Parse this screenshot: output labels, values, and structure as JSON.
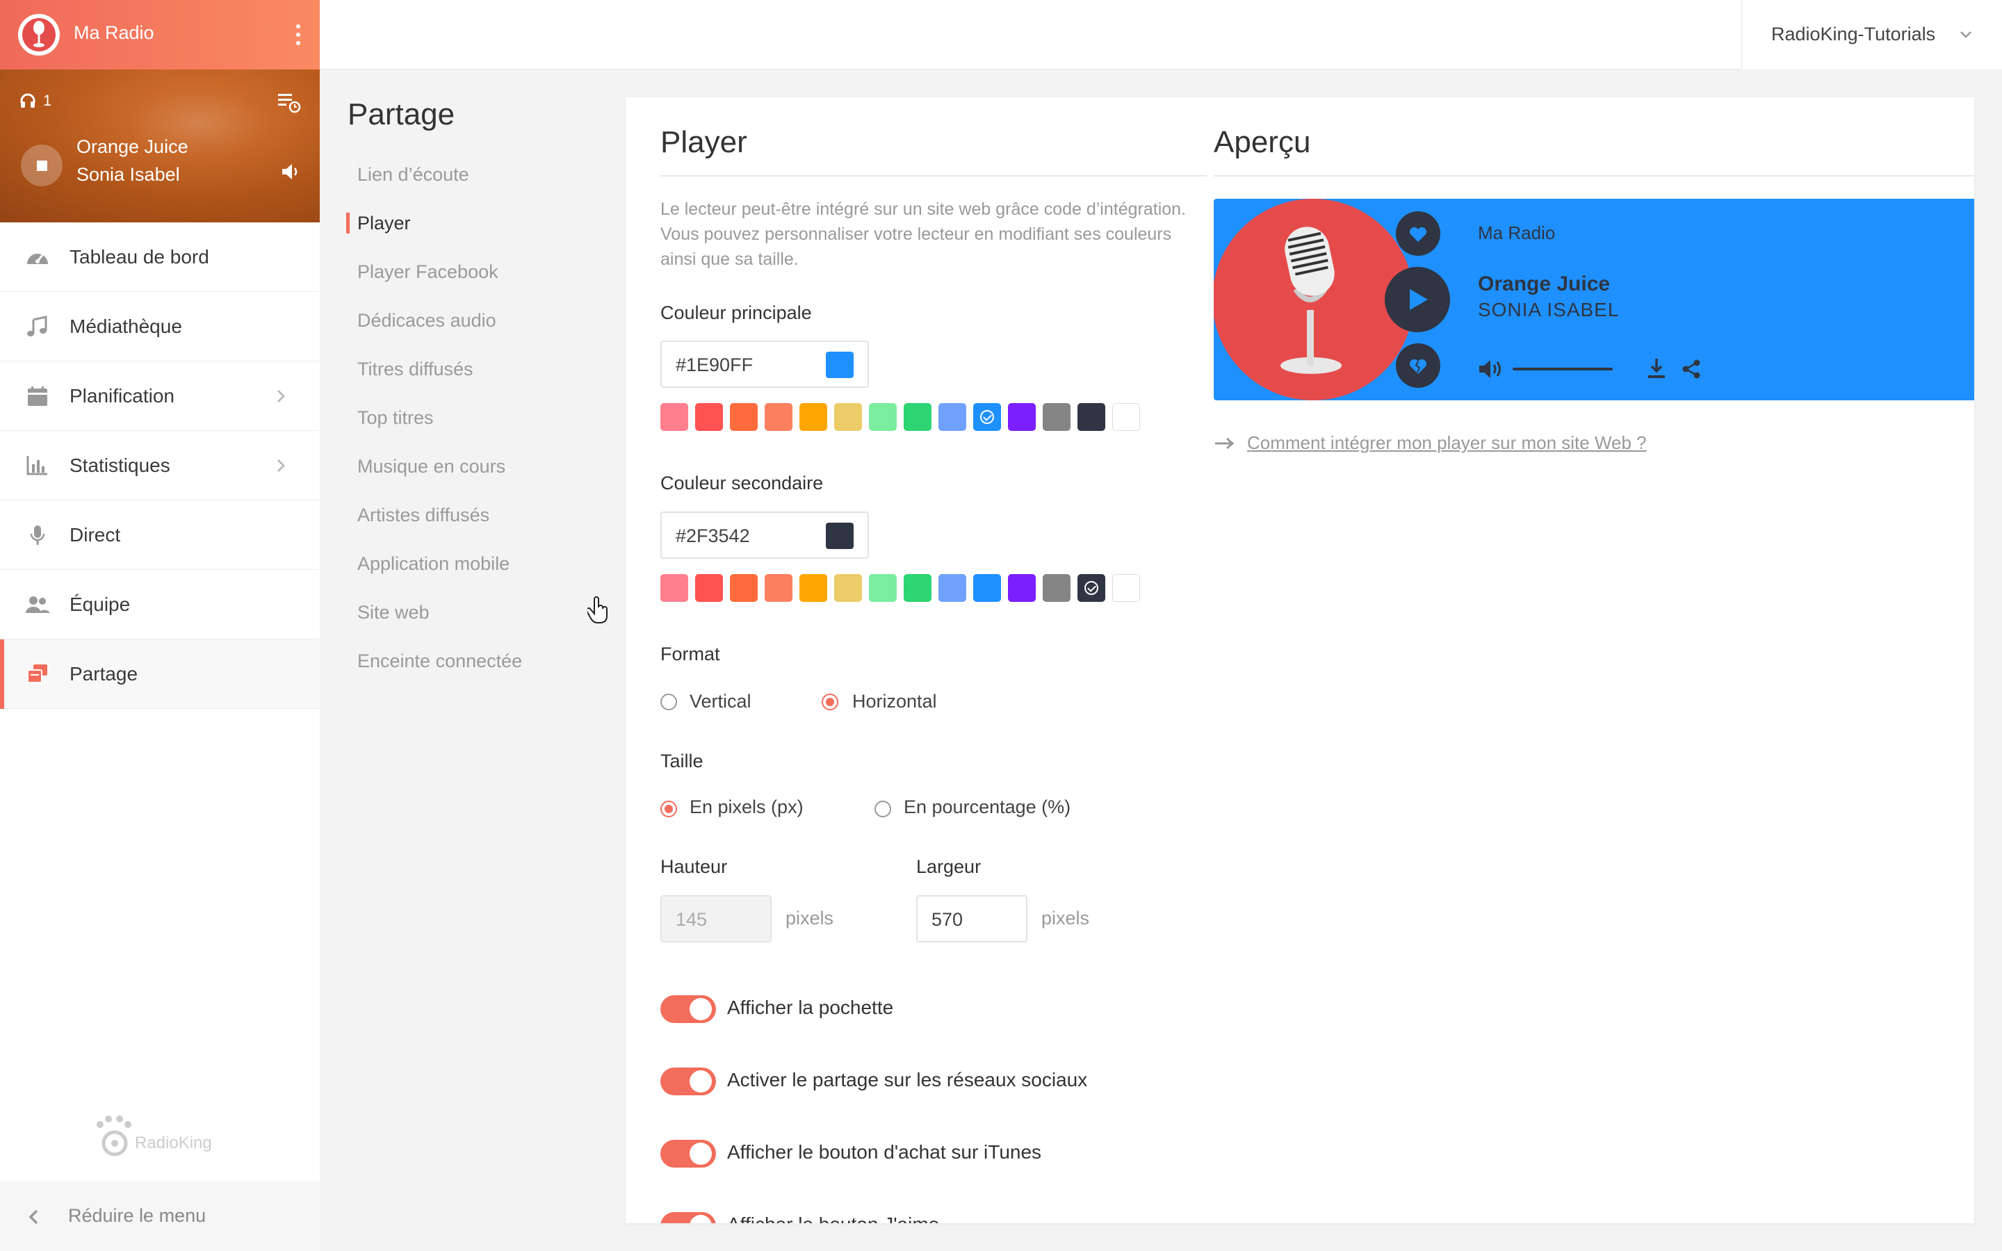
{
  "app": {
    "station_name": "Ma Radio",
    "account_name": "RadioKing-Tutorials",
    "brand_logo_text": "RadioKing"
  },
  "now_playing": {
    "listeners": "1",
    "title": "Orange Juice",
    "artist": "Sonia Isabel"
  },
  "sidebar": {
    "items": [
      {
        "label": "Tableau de bord",
        "icon": "dashboard-icon"
      },
      {
        "label": "Médiathèque",
        "icon": "music-note-icon"
      },
      {
        "label": "Planification",
        "icon": "calendar-icon",
        "has_chevron": true
      },
      {
        "label": "Statistiques",
        "icon": "bar-chart-icon",
        "has_chevron": true
      },
      {
        "label": "Direct",
        "icon": "microphone-icon"
      },
      {
        "label": "Équipe",
        "icon": "team-icon"
      },
      {
        "label": "Partage",
        "icon": "share-windows-icon",
        "active": true
      }
    ],
    "collapse_label": "Réduire le menu"
  },
  "subnav": {
    "title": "Partage",
    "items": [
      {
        "label": "Lien d’écoute"
      },
      {
        "label": "Player",
        "active": true
      },
      {
        "label": "Player Facebook"
      },
      {
        "label": "Dédicaces audio"
      },
      {
        "label": "Titres diffusés"
      },
      {
        "label": "Top titres"
      },
      {
        "label": "Musique en cours"
      },
      {
        "label": "Artistes diffusés"
      },
      {
        "label": "Application mobile"
      },
      {
        "label": "Site web"
      },
      {
        "label": "Enceinte connectée"
      }
    ]
  },
  "player_settings": {
    "title": "Player",
    "description": "Le lecteur peut-être intégré sur un site web grâce code d’intégration. Vous pouvez personnaliser votre lecteur en modifiant ses couleurs ainsi que sa taille.",
    "primary_color_label": "Couleur principale",
    "primary_color_value": "#1E90FF",
    "secondary_color_label": "Couleur secondaire",
    "secondary_color_value": "#2F3542",
    "swatches": [
      "#ff7f8e",
      "#ff5252",
      "#ff6b3d",
      "#fa8060",
      "#ffa502",
      "#eccc68",
      "#7bed9f",
      "#2ed573",
      "#70a1ff",
      "#1e90ff",
      "#7b1fff",
      "#858585",
      "#2f3542",
      "#ffffff"
    ],
    "primary_selected_index": 9,
    "secondary_selected_index": 12,
    "format_label": "Format",
    "format_options": [
      "Vertical",
      "Horizontal"
    ],
    "format_selected": "Horizontal",
    "size_label": "Taille",
    "size_options": [
      "En pixels (px)",
      "En pourcentage (%)"
    ],
    "size_selected": "En pixels (px)",
    "height_label": "Hauteur",
    "height_value": "145",
    "width_label": "Largeur",
    "width_value": "570",
    "unit_label": "pixels",
    "toggles": [
      {
        "label": "Afficher la pochette",
        "on": true
      },
      {
        "label": "Activer le partage sur les réseaux sociaux",
        "on": true
      },
      {
        "label": "Afficher le bouton d'achat sur iTunes",
        "on": true
      },
      {
        "label": "Afficher le bouton J'aime",
        "on": true
      }
    ]
  },
  "preview": {
    "title": "Aperçu",
    "station": "Ma Radio",
    "track_title": "Orange Juice",
    "track_artist": "SONIA ISABEL",
    "help_link": "Comment intégrer mon player sur mon site Web ?",
    "accent_color": "#1e90ff",
    "button_color": "#2f3542"
  },
  "colors": {
    "brand_accent": "#f26d5b"
  }
}
